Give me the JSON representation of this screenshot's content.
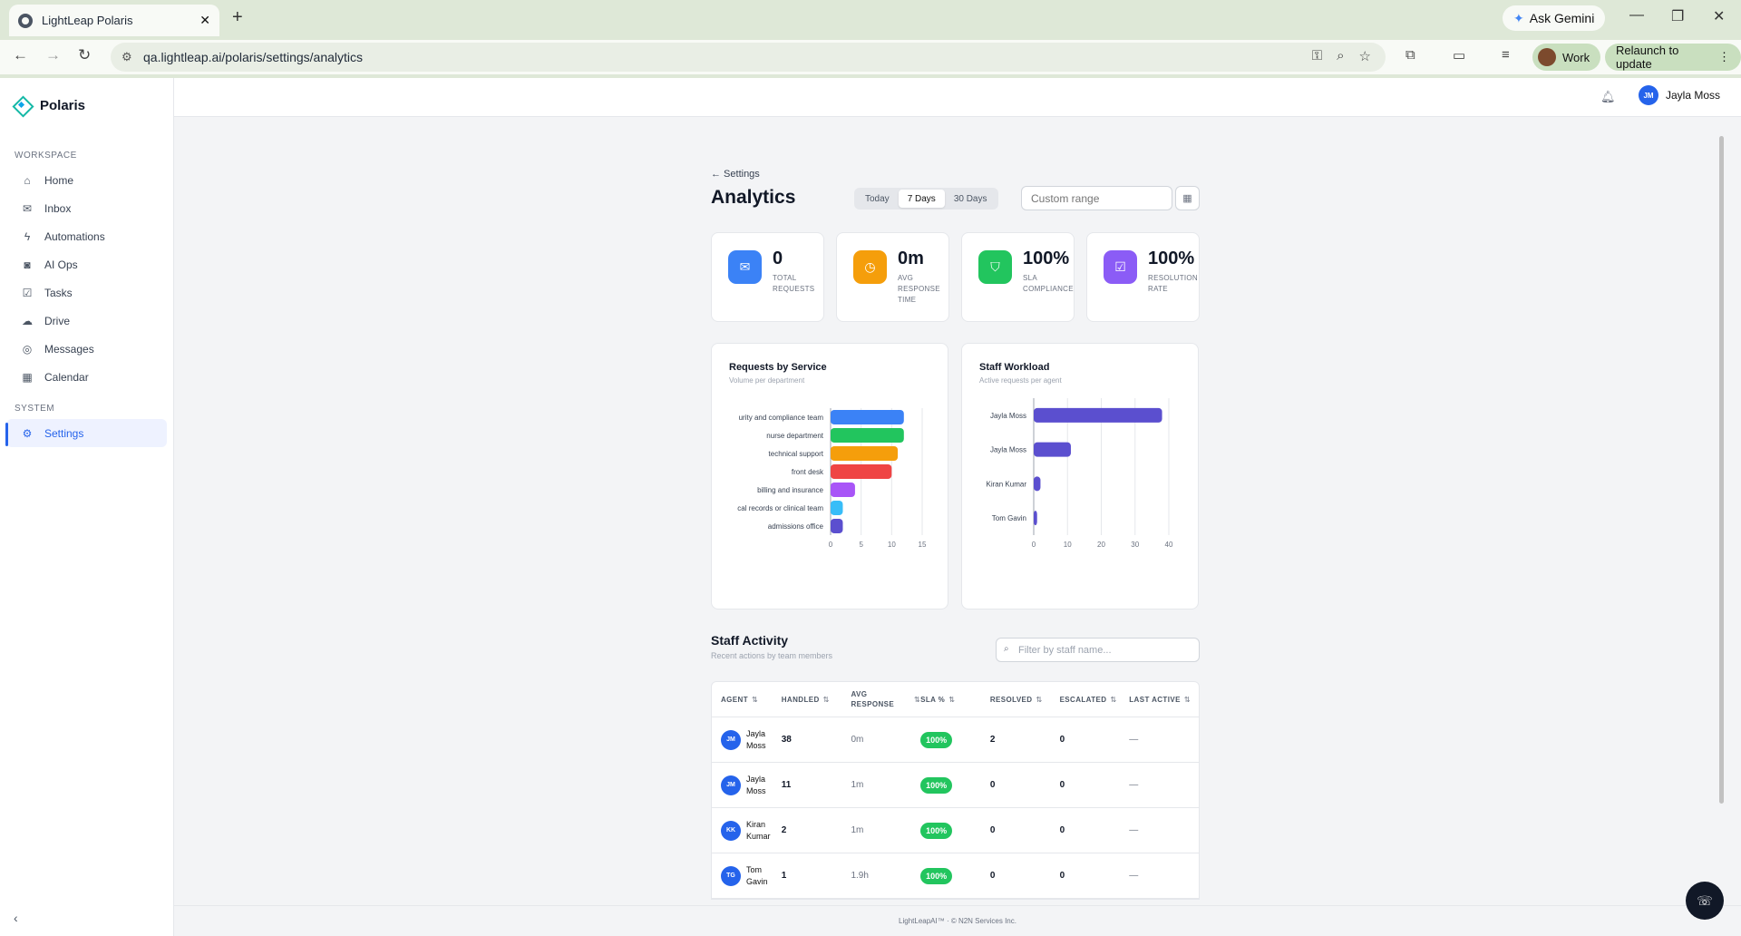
{
  "browser": {
    "tab_title": "LightLeap Polaris",
    "url": "qa.lightleap.ai/polaris/settings/analytics",
    "gemini_label": "Ask Gemini",
    "profile_label": "Work",
    "relaunch_label": "Relaunch to update"
  },
  "sidebar": {
    "brand": "Polaris",
    "workspace_label": "WORKSPACE",
    "items": [
      {
        "label": "Home",
        "icon": "home-icon"
      },
      {
        "label": "Inbox",
        "icon": "inbox-icon"
      },
      {
        "label": "Automations",
        "icon": "bolt-icon"
      },
      {
        "label": "AI Ops",
        "icon": "robot-icon"
      },
      {
        "label": "Tasks",
        "icon": "checkbox-icon"
      },
      {
        "label": "Drive",
        "icon": "cloud-icon"
      },
      {
        "label": "Messages",
        "icon": "message-icon"
      },
      {
        "label": "Calendar",
        "icon": "calendar-icon"
      }
    ],
    "system_label": "SYSTEM",
    "settings_label": "Settings"
  },
  "topbar": {
    "user_initials": "JM",
    "user_name": "Jayla Moss"
  },
  "page": {
    "breadcrumb": "← Settings",
    "title": "Analytics",
    "ranges": [
      "Today",
      "7 Days",
      "30 Days"
    ],
    "selected_range": "7 Days",
    "custom_range_placeholder": "Custom range"
  },
  "kpis": [
    {
      "value": "0",
      "label": "TOTAL REQUESTS",
      "color": "#3b82f6",
      "icon": "inbox-icon"
    },
    {
      "value": "0m",
      "label": "AVG RESPONSE TIME",
      "color": "#f59e0b",
      "icon": "timer-icon"
    },
    {
      "value": "100%",
      "label": "SLA COMPLIANCE",
      "color": "#22c55e",
      "icon": "shield-icon"
    },
    {
      "value": "100%",
      "label": "RESOLUTION RATE",
      "color": "#8b5cf6",
      "icon": "check-square-icon"
    }
  ],
  "chart_data": [
    {
      "type": "bar",
      "orientation": "horizontal",
      "title": "Requests by Service",
      "subtitle": "Volume per department",
      "categories": [
        "urity and compliance team",
        "nurse department",
        "technical support",
        "front desk",
        "billing and insurance",
        "cal records or clinical team",
        "admissions office"
      ],
      "values": [
        12,
        12,
        11,
        10,
        4,
        2,
        2
      ],
      "colors": [
        "#3b82f6",
        "#22c55e",
        "#f59e0b",
        "#ef4444",
        "#a855f7",
        "#38bdf8",
        "#5b4fcf"
      ],
      "xlim": [
        0,
        15
      ],
      "xticks": [
        0,
        5,
        10,
        15
      ],
      "grid": true
    },
    {
      "type": "bar",
      "orientation": "horizontal",
      "title": "Staff Workload",
      "subtitle": "Active requests per agent",
      "categories": [
        "Jayla Moss",
        "Jayla Moss",
        "Kiran Kumar",
        "Tom Gavin"
      ],
      "values": [
        38,
        11,
        2,
        1
      ],
      "colors": [
        "#5b4fcf",
        "#5b4fcf",
        "#5b4fcf",
        "#5b4fcf"
      ],
      "xlim": [
        0,
        40
      ],
      "xticks": [
        0,
        10,
        20,
        30,
        40
      ],
      "grid": true
    }
  ],
  "staff_activity": {
    "title": "Staff Activity",
    "subtitle": "Recent actions by team members",
    "filter_placeholder": "Filter by staff name...",
    "columns": [
      "AGENT",
      "HANDLED",
      "AVG RESPONSE",
      "SLA %",
      "RESOLVED",
      "ESCALATED",
      "LAST ACTIVE"
    ],
    "rows": [
      {
        "initials": "JM",
        "name": "Jayla Moss",
        "handled": "38",
        "avg": "0m",
        "sla": "100%",
        "resolved": "2",
        "escalated": "0",
        "last": "—"
      },
      {
        "initials": "JM",
        "name": "Jayla Moss",
        "handled": "11",
        "avg": "1m",
        "sla": "100%",
        "resolved": "0",
        "escalated": "0",
        "last": "—"
      },
      {
        "initials": "KK",
        "name": "Kiran Kumar",
        "handled": "2",
        "avg": "1m",
        "sla": "100%",
        "resolved": "0",
        "escalated": "0",
        "last": "—"
      },
      {
        "initials": "TG",
        "name": "Tom Gavin",
        "handled": "1",
        "avg": "1.9h",
        "sla": "100%",
        "resolved": "0",
        "escalated": "0",
        "last": "—"
      }
    ]
  },
  "footer": {
    "text": "LightLeapAI™ · © N2N Services Inc."
  }
}
